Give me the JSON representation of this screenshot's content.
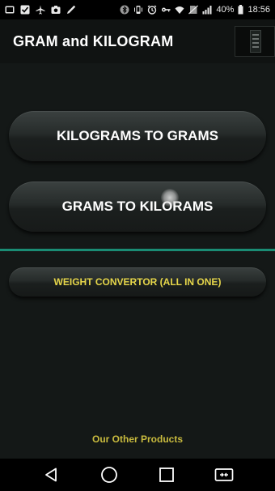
{
  "status_bar": {
    "battery_percent": "40%",
    "time": "18:56",
    "icons_left": [
      "gallery-icon",
      "checkbox-icon",
      "airplane-icon",
      "camera-icon",
      "pen-icon"
    ],
    "icons_right": [
      "bluetooth-icon",
      "vibrate-icon",
      "alarm-icon",
      "key-icon",
      "wifi-icon",
      "no-sim-icon",
      "signal-icon",
      "battery-icon"
    ]
  },
  "app_bar": {
    "title": "GRAM and KILOGRAM"
  },
  "main": {
    "kg_to_g_label": "KILOGRAMS TO GRAMS",
    "g_to_kg_label": "GRAMS TO KILORAMS",
    "all_in_one_label": "WEIGHT CONVERTOR (ALL IN ONE)",
    "other_products_label": "Our Other Products"
  },
  "colors": {
    "background": "#141817",
    "accent_divider": "#1a8c74",
    "yellow_text": "#e6d64a"
  },
  "nav_bar": {
    "icons": [
      "back-icon",
      "home-icon",
      "recents-icon",
      "screen-share-icon"
    ]
  }
}
